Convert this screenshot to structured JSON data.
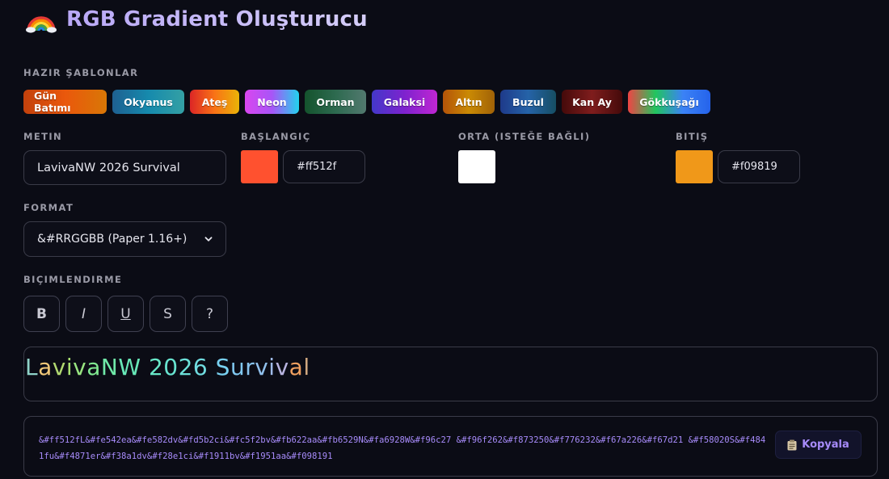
{
  "app": {
    "title": "RGB Gradient Oluşturucu",
    "title_icon": "rainbow-icon"
  },
  "presets": {
    "label": "HAZIR ŞABLONLAR",
    "items": [
      {
        "label": "Gün Batımı",
        "colors": [
          "#c2410c",
          "#ea580c",
          "#d97706"
        ]
      },
      {
        "label": "Okyanus",
        "colors": [
          "#1e6091",
          "#168aad",
          "#34a0a4"
        ]
      },
      {
        "label": "Ateş",
        "colors": [
          "#dc2626",
          "#f97316",
          "#eab308"
        ]
      },
      {
        "label": "Neon",
        "colors": [
          "#d946ef",
          "#a855f7",
          "#22d3ee"
        ]
      },
      {
        "label": "Orman",
        "colors": [
          "#14532d",
          "#2d6a4f",
          "#52796f"
        ]
      },
      {
        "label": "Galaksi",
        "colors": [
          "#4338ca",
          "#7e22ce",
          "#c026d3"
        ]
      },
      {
        "label": "Altın",
        "colors": [
          "#b45309",
          "#ca8a04",
          "#a16207"
        ]
      },
      {
        "label": "Buzul",
        "colors": [
          "#1e3a8a",
          "#2563a8",
          "#164e63"
        ]
      },
      {
        "label": "Kan Ay",
        "colors": [
          "#450a0a",
          "#7f1d1d",
          "#450a0a"
        ]
      },
      {
        "label": "Gökkuşağı",
        "colors": [
          "#ef4444",
          "#22c55e",
          "#3b82f6",
          "#2563eb"
        ]
      }
    ]
  },
  "text_field": {
    "label": "METIN",
    "value": "LavivaNW 2026 Survival"
  },
  "start_color": {
    "label": "BAŞLANGIÇ",
    "value": "#ff512f",
    "swatch": "#ff512f"
  },
  "middle_color": {
    "label": "ORTA (ISTEĞE BAĞLI)",
    "swatch": "#ffffff"
  },
  "end_color": {
    "label": "BITIŞ",
    "value": "#f09819",
    "swatch": "#f09819"
  },
  "format": {
    "label": "FORMAT",
    "selected": "&#RRGGBB (Paper 1.16+)"
  },
  "formatting": {
    "label": "BIÇIMLENDIRME",
    "buttons": [
      {
        "label": "B",
        "name": "bold-button"
      },
      {
        "label": "I",
        "name": "italic-button"
      },
      {
        "label": "U",
        "name": "underline-button"
      },
      {
        "label": "S",
        "name": "strikethrough-button"
      },
      {
        "label": "?",
        "name": "help-button"
      }
    ]
  },
  "preview": {
    "chars": [
      {
        "c": "L",
        "color": "#8fd3c8"
      },
      {
        "c": "a",
        "color": "#f0c878"
      },
      {
        "c": "v",
        "color": "#b0d870"
      },
      {
        "c": "i",
        "color": "#a8e070"
      },
      {
        "c": "v",
        "color": "#98e480"
      },
      {
        "c": "a",
        "color": "#80e890"
      },
      {
        "c": "N",
        "color": "#70e8a8"
      },
      {
        "c": "W",
        "color": "#68e8b8"
      },
      {
        "c": " ",
        "color": "#68e8c0"
      },
      {
        "c": "2",
        "color": "#68e8c8"
      },
      {
        "c": "0",
        "color": "#68e4d0"
      },
      {
        "c": "2",
        "color": "#6ce0d8"
      },
      {
        "c": "6",
        "color": "#70dce0"
      },
      {
        "c": " ",
        "color": "#74d8e8"
      },
      {
        "c": "S",
        "color": "#78d0f0"
      },
      {
        "c": "u",
        "color": "#80c8f0"
      },
      {
        "c": "r",
        "color": "#88c4ee"
      },
      {
        "c": "v",
        "color": "#90c0ec"
      },
      {
        "c": "i",
        "color": "#a0bcea"
      },
      {
        "c": "v",
        "color": "#b8b4e0"
      },
      {
        "c": "a",
        "color": "#f0a060"
      },
      {
        "c": "l",
        "color": "#d0a880"
      }
    ]
  },
  "output": {
    "code": "&#ff512fL&#fe542ea&#fe582dv&#fd5b2ci&#fc5f2bv&#fb622aa&#fb6529N&#fa6928W&#f96c27 &#f96f262&#f873250&#f776232&#f67a226&#f67d21 &#f58020S&#f4841fu&#f4871er&#f38a1dv&#f28e1ci&#f1911bv&#f1951aa&#f098191",
    "copy_label": "Kopyala",
    "copy_icon": "clipboard-icon"
  }
}
